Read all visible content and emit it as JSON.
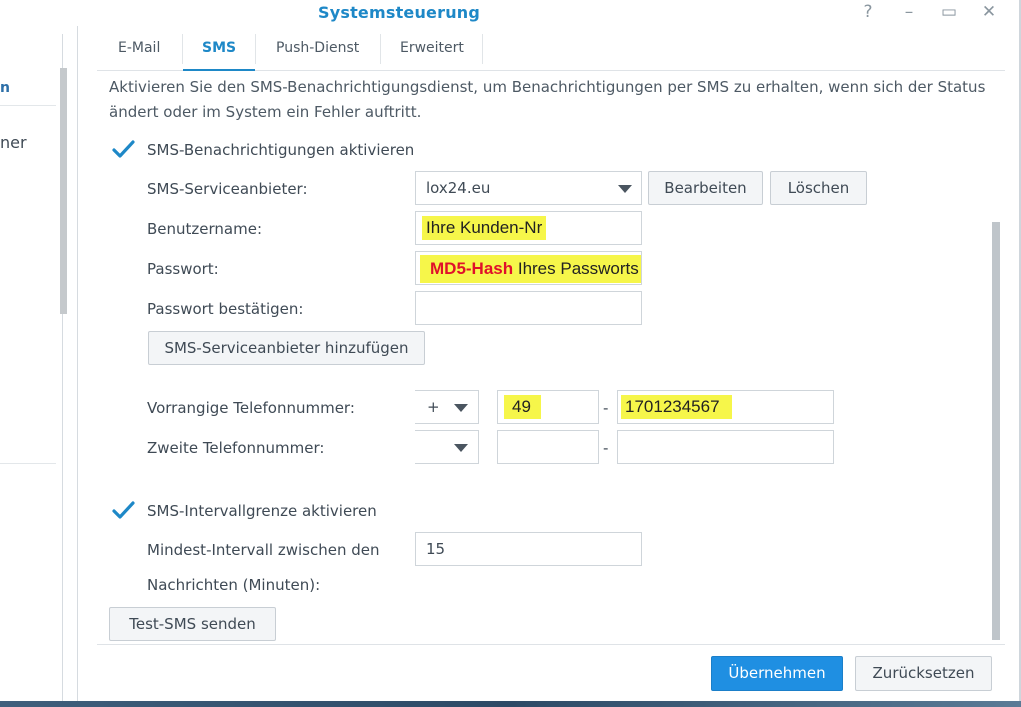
{
  "window": {
    "title": "Systemsteuerung",
    "controls": [
      "?",
      "–",
      "▭",
      "✕"
    ]
  },
  "left_panel": {
    "item_partial": "n",
    "item_partial2": "ner"
  },
  "tabs": [
    {
      "label": "E-Mail",
      "active": false
    },
    {
      "label": "SMS",
      "active": true
    },
    {
      "label": "Push-Dienst",
      "active": false
    },
    {
      "label": "Erweitert",
      "active": false
    }
  ],
  "description": {
    "line1": "Aktivieren Sie den SMS-Benachrichtigungsdienst, um Benachrichtigungen per SMS zu erhalten, wenn sich der Status",
    "line2": "ändert oder im System ein Fehler auftritt."
  },
  "sms_enable": {
    "label": "SMS-Benachrichtigungen aktivieren",
    "checked": true
  },
  "provider": {
    "label": "SMS-Serviceanbieter:",
    "selected": "lox24.eu",
    "edit_label": "Bearbeiten",
    "delete_label": "Löschen"
  },
  "username": {
    "label": "Benutzername:",
    "value": "Ihre Kunden-Nr"
  },
  "password": {
    "label": "Passwort:",
    "value_bold": "MD5-Hash",
    "value_rest": " Ihres Passworts"
  },
  "password_confirm": {
    "label": "Passwort bestätigen:",
    "value": ""
  },
  "add_provider_label": "SMS-Serviceanbieter hinzufügen",
  "primary_phone": {
    "label": "Vorrangige Telefonnummer:",
    "prefix": "+",
    "country": "49",
    "separator": "-",
    "number": "1701234567"
  },
  "secondary_phone": {
    "label": "Zweite Telefonnummer:",
    "prefix": "",
    "country": "",
    "separator": "-",
    "number": ""
  },
  "interval_enable": {
    "label": "SMS-Intervallgrenze aktivieren",
    "checked": true
  },
  "interval": {
    "label_line1": "Mindest-Intervall zwischen den",
    "label_line2": "Nachrichten (Minuten):",
    "value": "15"
  },
  "test_sms_label": "Test-SMS senden",
  "apply_label": "Übernehmen",
  "reset_label": "Zurücksetzen",
  "colors": {
    "accent": "#1e88c7",
    "highlight": "#f6f64a",
    "bold_red": "#e0102a"
  }
}
